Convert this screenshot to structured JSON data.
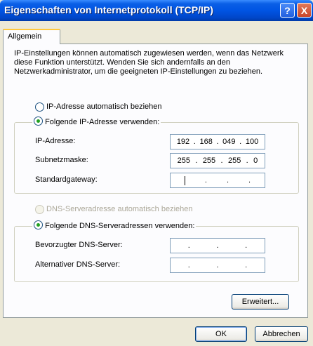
{
  "window": {
    "title": "Eigenschaften von Internetprotokoll (TCP/IP)",
    "help_label": "?",
    "close_label": "X"
  },
  "tabs": [
    {
      "label": "Allgemein",
      "active": true
    }
  ],
  "intro_text": "IP-Einstellungen können automatisch zugewiesen werden, wenn das Netzwerk diese Funktion unterstützt. Wenden Sie sich andernfalls an den Netzwerkadministrator, um die geeigneten IP-Einstellungen zu beziehen.",
  "ip_options": {
    "auto_label": "IP-Adresse automatisch beziehen",
    "manual_label": "Folgende IP-Adresse verwenden:",
    "selected": "manual"
  },
  "ip_fields": {
    "ip_address": {
      "label": "IP-Adresse:",
      "octets": [
        "192",
        "168",
        "049",
        "100"
      ]
    },
    "subnet_mask": {
      "label": "Subnetzmaske:",
      "octets": [
        "255",
        "255",
        "255",
        "0"
      ]
    },
    "gateway": {
      "label": "Standardgateway:",
      "octets": [
        "",
        "",
        "",
        ""
      ]
    },
    "separator": "."
  },
  "dns_options": {
    "auto_label": "DNS-Serveradresse automatisch beziehen",
    "auto_disabled": true,
    "manual_label": "Folgende DNS-Serveradressen verwenden:",
    "selected": "manual"
  },
  "dns_fields": {
    "preferred": {
      "label": "Bevorzugter DNS-Server:",
      "octets": [
        "",
        "",
        "",
        ""
      ]
    },
    "alternate": {
      "label": "Alternativer DNS-Server:",
      "octets": [
        "",
        "",
        "",
        ""
      ]
    }
  },
  "buttons": {
    "advanced": "Erweitert...",
    "ok": "OK",
    "cancel": "Abbrechen"
  }
}
